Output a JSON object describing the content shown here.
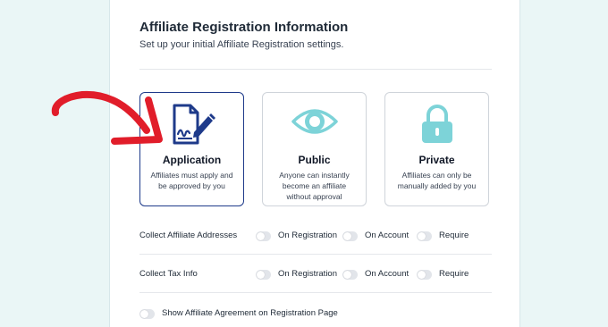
{
  "header": {
    "title": "Affiliate Registration Information",
    "subtitle": "Set up your initial Affiliate Registration settings."
  },
  "cards": [
    {
      "title": "Application",
      "description": "Affiliates must apply and be approved by you",
      "icon": "application-document-icon",
      "selected": true
    },
    {
      "title": "Public",
      "description": "Anyone can instantly become an affiliate without approval",
      "icon": "eye-icon",
      "selected": false
    },
    {
      "title": "Private",
      "description": "Affiliates can only be manually added by you",
      "icon": "lock-icon",
      "selected": false
    }
  ],
  "settings": {
    "addresses": {
      "label": "Collect Affiliate Addresses",
      "options": [
        "On Registration",
        "On Account",
        "Require"
      ]
    },
    "tax": {
      "label": "Collect Tax Info",
      "options": [
        "On Registration",
        "On Account",
        "Require"
      ]
    },
    "agreement": {
      "label": "Show Affiliate Agreement on Registration Page"
    }
  },
  "colors": {
    "background": "#eaf6f6",
    "selected_border": "#1e3a8a",
    "icon_blue": "#1e3a8a",
    "icon_teal": "#7dd3d8",
    "arrow_red": "#e11d2a",
    "toggle_off": "#e2e5ea"
  }
}
